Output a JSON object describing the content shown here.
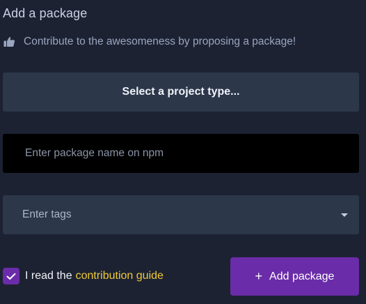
{
  "form": {
    "title": "Add a package",
    "subtitle": "Contribute to the awesomeness by proposing a package!",
    "subtitle_icon": "thumbs-up-icon",
    "project_type_label": "Select a project type...",
    "package_name": {
      "value": "",
      "placeholder": "Enter package name on npm"
    },
    "tags": {
      "placeholder": "Enter tags"
    },
    "consent": {
      "checked": true,
      "text": "I read the",
      "link_label": "contribution guide"
    },
    "submit": {
      "icon": "plus-icon",
      "plus_glyph": "+",
      "label": "Add package"
    }
  },
  "colors": {
    "background": "#1c2232",
    "panel": "#2d374a",
    "accent_purple": "#6a2ca8",
    "link_yellow": "#f0c93a"
  }
}
